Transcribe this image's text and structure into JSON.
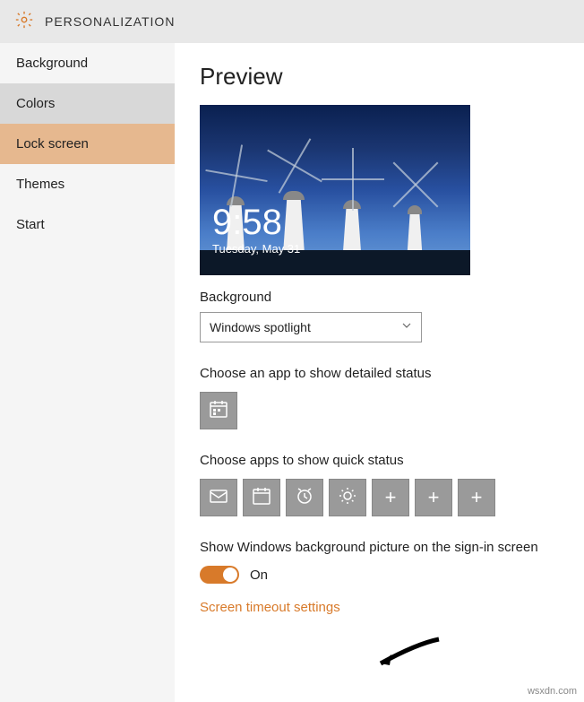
{
  "header": {
    "title": "PERSONALIZATION"
  },
  "sidebar": {
    "items": [
      {
        "label": "Background",
        "state": ""
      },
      {
        "label": "Colors",
        "state": "hover"
      },
      {
        "label": "Lock screen",
        "state": "selected"
      },
      {
        "label": "Themes",
        "state": ""
      },
      {
        "label": "Start",
        "state": ""
      }
    ]
  },
  "main": {
    "preview": {
      "title": "Preview",
      "time": "9:58",
      "date": "Tuesday, May 31"
    },
    "background": {
      "label": "Background",
      "selected": "Windows spotlight"
    },
    "detailed": {
      "label": "Choose an app to show detailed status",
      "apps": [
        "calendar-icon"
      ]
    },
    "quick": {
      "label": "Choose apps to show quick status",
      "apps": [
        "mail-icon",
        "calendar-icon",
        "alarm-icon",
        "weather-icon",
        "plus",
        "plus",
        "plus"
      ]
    },
    "signin": {
      "label": "Show Windows background picture on the sign-in screen",
      "state_label": "On",
      "on": true
    },
    "link": "Screen timeout settings"
  },
  "watermark": "wsxdn.com",
  "colors": {
    "accent": "#d87a2a"
  }
}
